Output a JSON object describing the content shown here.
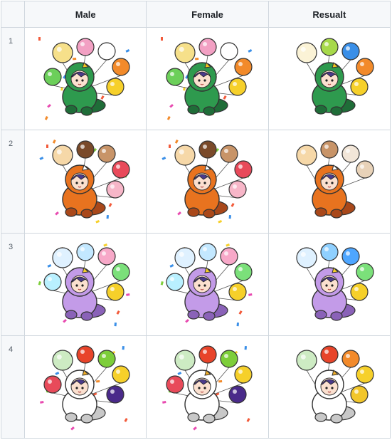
{
  "table": {
    "headers": [
      "",
      "Male",
      "Female",
      "Resualt"
    ],
    "rows": [
      {
        "index": "1",
        "costume": "dinosaur",
        "costume_color": "#2e9a4e",
        "costume_shade": "#1f6d38",
        "accent": "#f4c61f",
        "cells": [
          {
            "name": "male-dinosaur-sprite",
            "balloons": [
              "#f6e08a",
              "#f2a0c3",
              "#ffffff",
              "#f28a2a",
              "#f6d02a",
              "#6ccf5a"
            ]
          },
          {
            "name": "female-dinosaur-sprite",
            "balloons": [
              "#f6e08a",
              "#f2a0c3",
              "#ffffff",
              "#f28a2a",
              "#f6d02a",
              "#6ccf5a"
            ]
          },
          {
            "name": "result-dinosaur-sprite",
            "balloons": [
              "#fbf3d6",
              "#a7d94a",
              "#3a8fe8",
              "#f28a2a",
              "#f6d02a"
            ]
          }
        ]
      },
      {
        "index": "2",
        "costume": "red-panda",
        "costume_color": "#e8731f",
        "costume_shade": "#a9481a",
        "accent": "#ffffff",
        "cells": [
          {
            "name": "male-red-panda-sprite",
            "balloons": [
              "#f6d8a8",
              "#7a4a2a",
              "#c89468",
              "#e84a5a",
              "#f7b6c8"
            ]
          },
          {
            "name": "female-red-panda-sprite",
            "balloons": [
              "#f6d8a8",
              "#7a4a2a",
              "#c89468",
              "#e84a5a",
              "#f7b6c8"
            ]
          },
          {
            "name": "result-red-panda-sprite",
            "balloons": [
              "#f6d8a8",
              "#c89468",
              "#f2e6d8",
              "#e8d2b8"
            ]
          }
        ]
      },
      {
        "index": "3",
        "costume": "unicorn",
        "costume_color": "#c39be8",
        "costume_shade": "#8a62b8",
        "accent": "#f6d02a",
        "cells": [
          {
            "name": "male-unicorn-sprite",
            "balloons": [
              "#dff1ff",
              "#c3e8ff",
              "#f7a8c8",
              "#7be07a",
              "#f6d02a",
              "#b9f0ff"
            ]
          },
          {
            "name": "female-unicorn-sprite",
            "balloons": [
              "#dff1ff",
              "#c3e8ff",
              "#f7a8c8",
              "#7be07a",
              "#f6d02a",
              "#b9f0ff"
            ]
          },
          {
            "name": "result-unicorn-sprite",
            "balloons": [
              "#dff1ff",
              "#8fd0ff",
              "#4ea6ff",
              "#7be07a",
              "#f6d02a"
            ]
          }
        ]
      },
      {
        "index": "4",
        "costume": "duck",
        "costume_color": "#ffffff",
        "costume_shade": "#c8c8c8",
        "accent": "#f2b02a",
        "cells": [
          {
            "name": "male-duck-sprite",
            "balloons": [
              "#cdebc3",
              "#e8442a",
              "#7dce3a",
              "#f6d02a",
              "#4a2a8a",
              "#e84a5a"
            ]
          },
          {
            "name": "female-duck-sprite",
            "balloons": [
              "#cdebc3",
              "#e8442a",
              "#7dce3a",
              "#f6d02a",
              "#4a2a8a",
              "#e84a5a"
            ]
          },
          {
            "name": "result-duck-sprite",
            "balloons": [
              "#cdebc3",
              "#e8442a",
              "#f28a2a",
              "#f6d02a",
              "#f2c62a"
            ]
          }
        ]
      }
    ]
  }
}
